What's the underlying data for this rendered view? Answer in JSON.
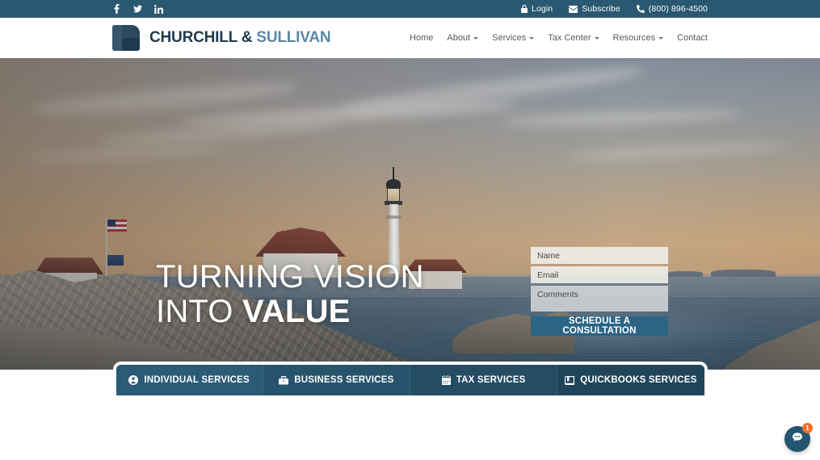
{
  "topbar": {
    "social": [
      {
        "name": "facebook-icon",
        "label": "Facebook"
      },
      {
        "name": "twitter-icon",
        "label": "Twitter"
      },
      {
        "name": "linkedin-icon",
        "label": "LinkedIn"
      }
    ],
    "login": "Login",
    "subscribe": "Subscribe",
    "phone": "(800) 896-4500",
    "background_color": "#2a5871"
  },
  "header": {
    "logo": {
      "primary": "CHURCHILL &",
      "secondary": "SULLIVAN",
      "primary_color": "#203a4d",
      "secondary_color": "#5b87a6"
    },
    "nav": [
      {
        "label": "Home",
        "has_dropdown": false
      },
      {
        "label": "About",
        "has_dropdown": true
      },
      {
        "label": "Services",
        "has_dropdown": true
      },
      {
        "label": "Tax Center",
        "has_dropdown": true
      },
      {
        "label": "Resources",
        "has_dropdown": true
      },
      {
        "label": "Contact",
        "has_dropdown": false
      }
    ]
  },
  "hero": {
    "title_line1": "TURNING VISION",
    "title_line2_light": "INTO ",
    "title_line2_bold": "VALUE",
    "form": {
      "name_placeholder": "Name",
      "email_placeholder": "Email",
      "comments_placeholder": "Comments",
      "submit_label": "SCHEDULE A CONSULTATION",
      "submit_color": "#2c6484"
    }
  },
  "services": {
    "tabs": [
      {
        "label": "INDIVIDUAL SERVICES",
        "icon": "person-circle-icon",
        "color": "#2b5b76"
      },
      {
        "label": "BUSINESS SERVICES",
        "icon": "briefcase-icon",
        "color": "#27536c"
      },
      {
        "label": "TAX SERVICES",
        "icon": "calendar-icon",
        "color": "#244c64"
      },
      {
        "label": "QUICKBOOKS SERVICES",
        "icon": "book-icon",
        "color": "#20455b"
      }
    ]
  },
  "chat": {
    "icon": "chat-bubble-icon",
    "badge_count": "1",
    "badge_color": "#ef6c28",
    "button_color": "#23566f"
  }
}
